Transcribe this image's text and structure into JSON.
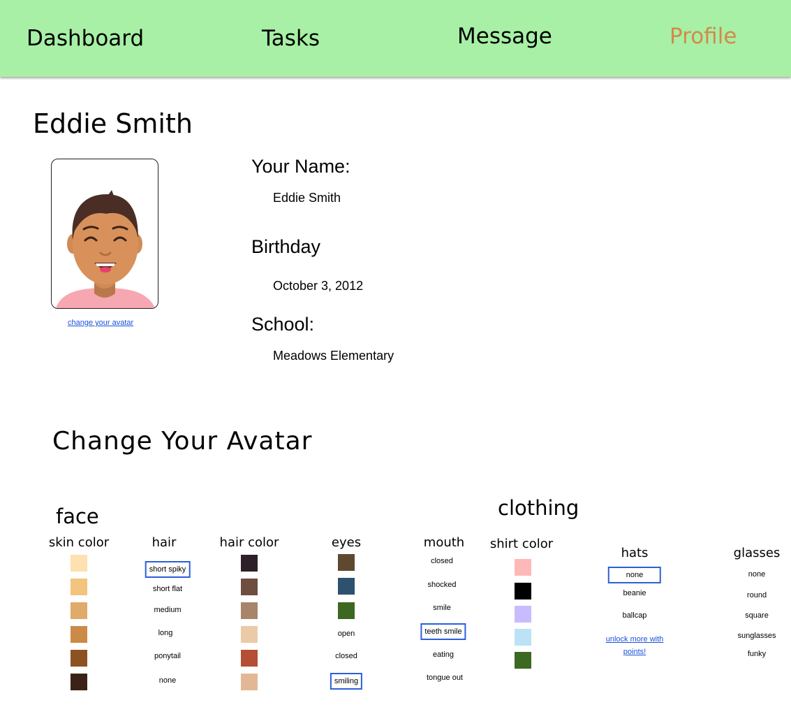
{
  "nav": {
    "dashboard": "Dashboard",
    "tasks": "Tasks",
    "message": "Message",
    "profile": "Profile"
  },
  "colors": {
    "nav_bg": "#a7f0a5",
    "active_tab": "#d4894a",
    "link": "#1a50d8",
    "selected_border": "#2b5fd9"
  },
  "profile": {
    "display_name": "Eddie Smith",
    "change_avatar_link": "change your avatar",
    "name_label": "Your Name:",
    "name_value": "Eddie Smith",
    "birthday_label": "Birthday",
    "birthday_value": "October 3, 2012",
    "school_label": "School:",
    "school_value": "Meadows Elementary"
  },
  "editor": {
    "title": "Change Your Avatar",
    "face_section": "face",
    "clothing_section": "clothing",
    "skin_color": {
      "label": "skin color",
      "swatches": [
        "#ffe0b0",
        "#f3c47e",
        "#e0aa6a",
        "#cc8a48",
        "#8d5222",
        "#3a2218"
      ]
    },
    "hair": {
      "label": "hair",
      "options": [
        "short spiky",
        "short flat",
        "medium",
        "long",
        "ponytail",
        "none"
      ],
      "selected": "short spiky"
    },
    "hair_color": {
      "label": "hair color",
      "swatches": [
        "#2e2029",
        "#6e4e3e",
        "#a8846a",
        "#ebcaa8",
        "#b44e35",
        "#e2b894"
      ]
    },
    "eyes": {
      "label": "eyes",
      "swatches": [
        "#5e4930",
        "#2c5270",
        "#3c6822"
      ],
      "options": [
        "open",
        "closed",
        "smiling"
      ],
      "selected": "smiling"
    },
    "mouth": {
      "label": "mouth",
      "options": [
        "closed",
        "shocked",
        "smile",
        "teeth smile",
        "eating",
        "tongue out"
      ],
      "selected": "teeth smile"
    },
    "shirt_color": {
      "label": "shirt color",
      "swatches": [
        "#ffb8b8",
        "#000000",
        "#c8bcff",
        "#bce2f6",
        "#3c6822"
      ]
    },
    "hats": {
      "label": "hats",
      "options": [
        "none",
        "beanie",
        "ballcap"
      ],
      "selected": "none",
      "unlock_link": "unlock more with points!"
    },
    "glasses": {
      "label": "glasses",
      "options": [
        "none",
        "round",
        "square",
        "sunglasses",
        "funky"
      ]
    }
  }
}
